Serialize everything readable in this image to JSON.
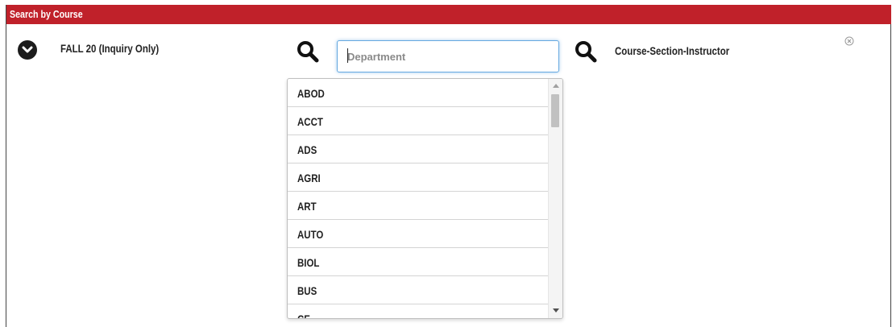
{
  "header": {
    "title": "Search by Course"
  },
  "term": {
    "label": "FALL 20 (Inquiry Only)"
  },
  "department": {
    "placeholder": "Department"
  },
  "course_section_instructor": {
    "label": "Course-Section-Instructor"
  },
  "dropdown": {
    "options": [
      "ABOD",
      "ACCT",
      "ADS",
      "AGRI",
      "ART",
      "AUTO",
      "BIOL",
      "BUS",
      "CE"
    ]
  },
  "colors": {
    "header_bg": "#c0212a",
    "focus_border": "#66a9e0"
  }
}
